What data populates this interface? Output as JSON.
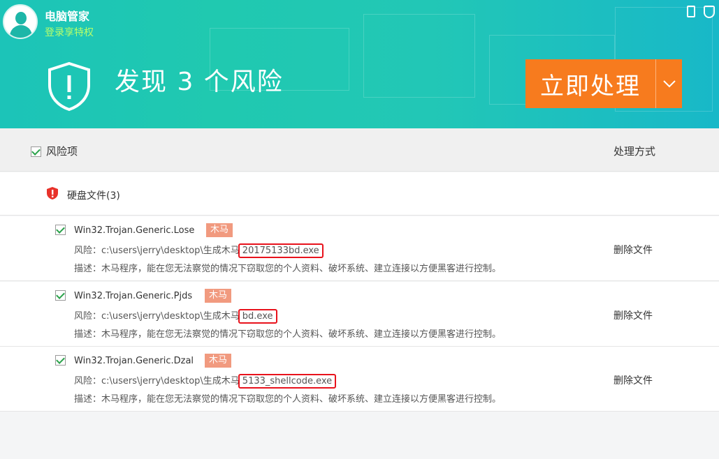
{
  "header": {
    "app_title": "电脑管家",
    "login_link": "登录享特权",
    "headline": "发现 3 个风险",
    "primary_button": "立即处理"
  },
  "columns": {
    "risk": "风险项",
    "action": "处理方式"
  },
  "group": {
    "label": "硬盘文件(3)"
  },
  "items": [
    {
      "name": "Win32.Trojan.Generic.Lose",
      "tag": "木马",
      "path_prefix": "风险：c:\\users\\jerry\\desktop\\生成木马",
      "file": "20175133bd.exe",
      "desc": "描述：木马程序，能在您无法察觉的情况下窃取您的个人资料、破坏系统、建立连接以方便黑客进行控制。",
      "action": "删除文件"
    },
    {
      "name": "Win32.Trojan.Generic.Pjds",
      "tag": "木马",
      "path_prefix": "风险：c:\\users\\jerry\\desktop\\生成木马",
      "file": "bd.exe",
      "desc": "描述：木马程序，能在您无法察觉的情况下窃取您的个人资料、破坏系统、建立连接以方便黑客进行控制。",
      "action": "删除文件"
    },
    {
      "name": "Win32.Trojan.Generic.Dzal",
      "tag": "木马",
      "path_prefix": "风险：c:\\users\\jerry\\desktop\\生成木马",
      "file": "5133_shellcode.exe",
      "desc": "描述：木马程序，能在您无法察觉的情况下窃取您的个人资料、破坏系统、建立连接以方便黑客进行控制。",
      "action": "删除文件"
    }
  ],
  "colors": {
    "header_teal": "#20c9b0",
    "action_orange": "#f77b1e",
    "tag_salmon": "#f19a7f",
    "highlight_red": "#e8121c",
    "check_green": "#2aa24a",
    "login_green": "#b8ff6a"
  },
  "icons": {
    "avatar": "user-avatar",
    "top_right": [
      "phone-icon",
      "shield-icon"
    ],
    "headline": "shield-exclamation-icon",
    "button_caret": "chevron-down-icon",
    "group": "red-shield-warning-icon"
  }
}
